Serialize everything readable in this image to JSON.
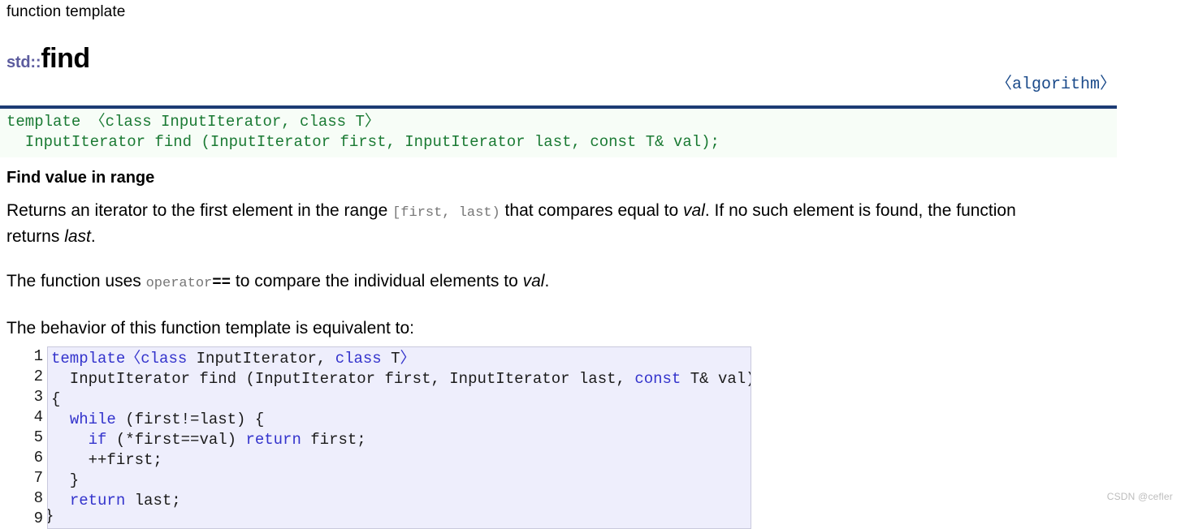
{
  "header": {
    "kind": "function template",
    "namespace": "std::",
    "name": "find",
    "include": "〈algorithm〉"
  },
  "signature": {
    "line1": "template 〈class InputIterator, class T〉",
    "line2": "  InputIterator find (InputIterator first, InputIterator last, const T& val);"
  },
  "section": {
    "title": "Find value in range"
  },
  "paragraphs": {
    "p1_a": "Returns an iterator to the first element in the range ",
    "p1_code": "[first, last)",
    "p1_b": " that compares equal to ",
    "p1_val": "val",
    "p1_c": ". If no such element is found, the function returns ",
    "p1_last": "last",
    "p1_d": ".",
    "p2_a": "The function uses ",
    "p2_code": "operator",
    "p2_eq": "==",
    "p2_b": " to compare the individual elements to ",
    "p2_val": "val",
    "p2_c": ".",
    "p3": "The behavior of this function template is equivalent to:"
  },
  "code_block": {
    "line_numbers": [
      "1",
      "2",
      "3",
      "4",
      "5",
      "6",
      "7",
      "8",
      "9"
    ],
    "lines": [
      {
        "n": "1",
        "segments": [
          {
            "t": "template",
            "c": "kw"
          },
          {
            "t": "〈",
            "c": "kw"
          },
          {
            "t": "class",
            "c": "kw"
          },
          {
            "t": " InputIterator, ",
            "c": "pl"
          },
          {
            "t": "class",
            "c": "kw"
          },
          {
            "t": " T",
            "c": "pl"
          },
          {
            "t": "〉",
            "c": "kw"
          }
        ]
      },
      {
        "n": "2",
        "segments": [
          {
            "t": "  InputIterator find (InputIterator first, InputIterator last, ",
            "c": "pl"
          },
          {
            "t": "const",
            "c": "kw"
          },
          {
            "t": " T& val)",
            "c": "pl"
          }
        ]
      },
      {
        "n": "3",
        "segments": [
          {
            "t": "{",
            "c": "pl"
          }
        ]
      },
      {
        "n": "4",
        "segments": [
          {
            "t": "  ",
            "c": "pl"
          },
          {
            "t": "while",
            "c": "kw"
          },
          {
            "t": " (first!=last) {",
            "c": "pl"
          }
        ]
      },
      {
        "n": "5",
        "segments": [
          {
            "t": "    ",
            "c": "pl"
          },
          {
            "t": "if",
            "c": "kw"
          },
          {
            "t": " (*first==val) ",
            "c": "pl"
          },
          {
            "t": "return",
            "c": "kw"
          },
          {
            "t": " first;",
            "c": "pl"
          }
        ]
      },
      {
        "n": "6",
        "segments": [
          {
            "t": "    ++first;",
            "c": "pl"
          }
        ]
      },
      {
        "n": "7",
        "segments": [
          {
            "t": "  }",
            "c": "pl"
          }
        ]
      },
      {
        "n": "8",
        "segments": [
          {
            "t": "  ",
            "c": "pl"
          },
          {
            "t": "return",
            "c": "kw"
          },
          {
            "t": " last;",
            "c": "pl"
          }
        ]
      },
      {
        "n": "9",
        "segments": [
          {
            "t": "}",
            "c": "pl"
          }
        ]
      }
    ]
  },
  "watermark": "CSDN @cefler",
  "colors": {
    "rule": "#1d3c75",
    "signature_text": "#1a7a33",
    "signature_bg": "#f7fdf7",
    "namespace": "#5c5c9e",
    "include": "#1a4a8a",
    "code_bg": "#eeeefc",
    "code_border": "#c9c9dd",
    "keyword": "#3333cc",
    "line_number": "#a8a8a8",
    "inline_code": "#777777",
    "watermark": "#bdbdbd"
  }
}
